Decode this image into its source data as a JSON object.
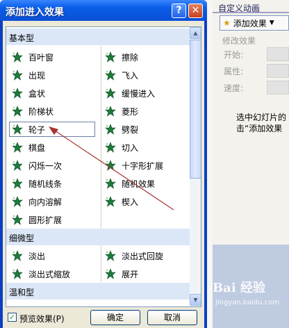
{
  "dialog": {
    "title": "添加进入效果",
    "help_glyph": "?",
    "close_glyph": "✕"
  },
  "groups": [
    {
      "label": "基本型"
    },
    {
      "label": "细微型"
    },
    {
      "label": "温和型"
    }
  ],
  "basic_left": [
    "百叶窗",
    "出现",
    "盒状",
    "阶梯状",
    "轮子",
    "棋盘",
    "闪烁一次",
    "随机线条",
    "向内溶解",
    "圆形扩展"
  ],
  "basic_right": [
    "擦除",
    "飞入",
    "缓慢进入",
    "菱形",
    "劈裂",
    "切入",
    "十字形扩展",
    "随机效果",
    "楔入"
  ],
  "subtle_left": [
    "淡出",
    "淡出式缩放"
  ],
  "subtle_right": [
    "淡出式回旋",
    "展开"
  ],
  "selected_item": "轮子",
  "footer": {
    "preview_label": "预览效果(P)",
    "preview_checked": true,
    "ok_label": "确定",
    "cancel_label": "取消"
  },
  "task_pane": {
    "title": "自定义动画",
    "add_effect_label": "添加效果",
    "modify_label": "修改效果",
    "props": [
      "开始:",
      "属性:",
      "速度:"
    ],
    "hint_line1": "选中幻灯片的",
    "hint_line2": "击“添加效果"
  },
  "watermark": {
    "brand": "Bai 经验",
    "url": "jingyan.baidu.com"
  },
  "colors": {
    "titlebar": "#0a4fd6",
    "group_header": "#dbe7f7",
    "arrow": "#a83232",
    "icon_green": "#1e7a3a"
  }
}
